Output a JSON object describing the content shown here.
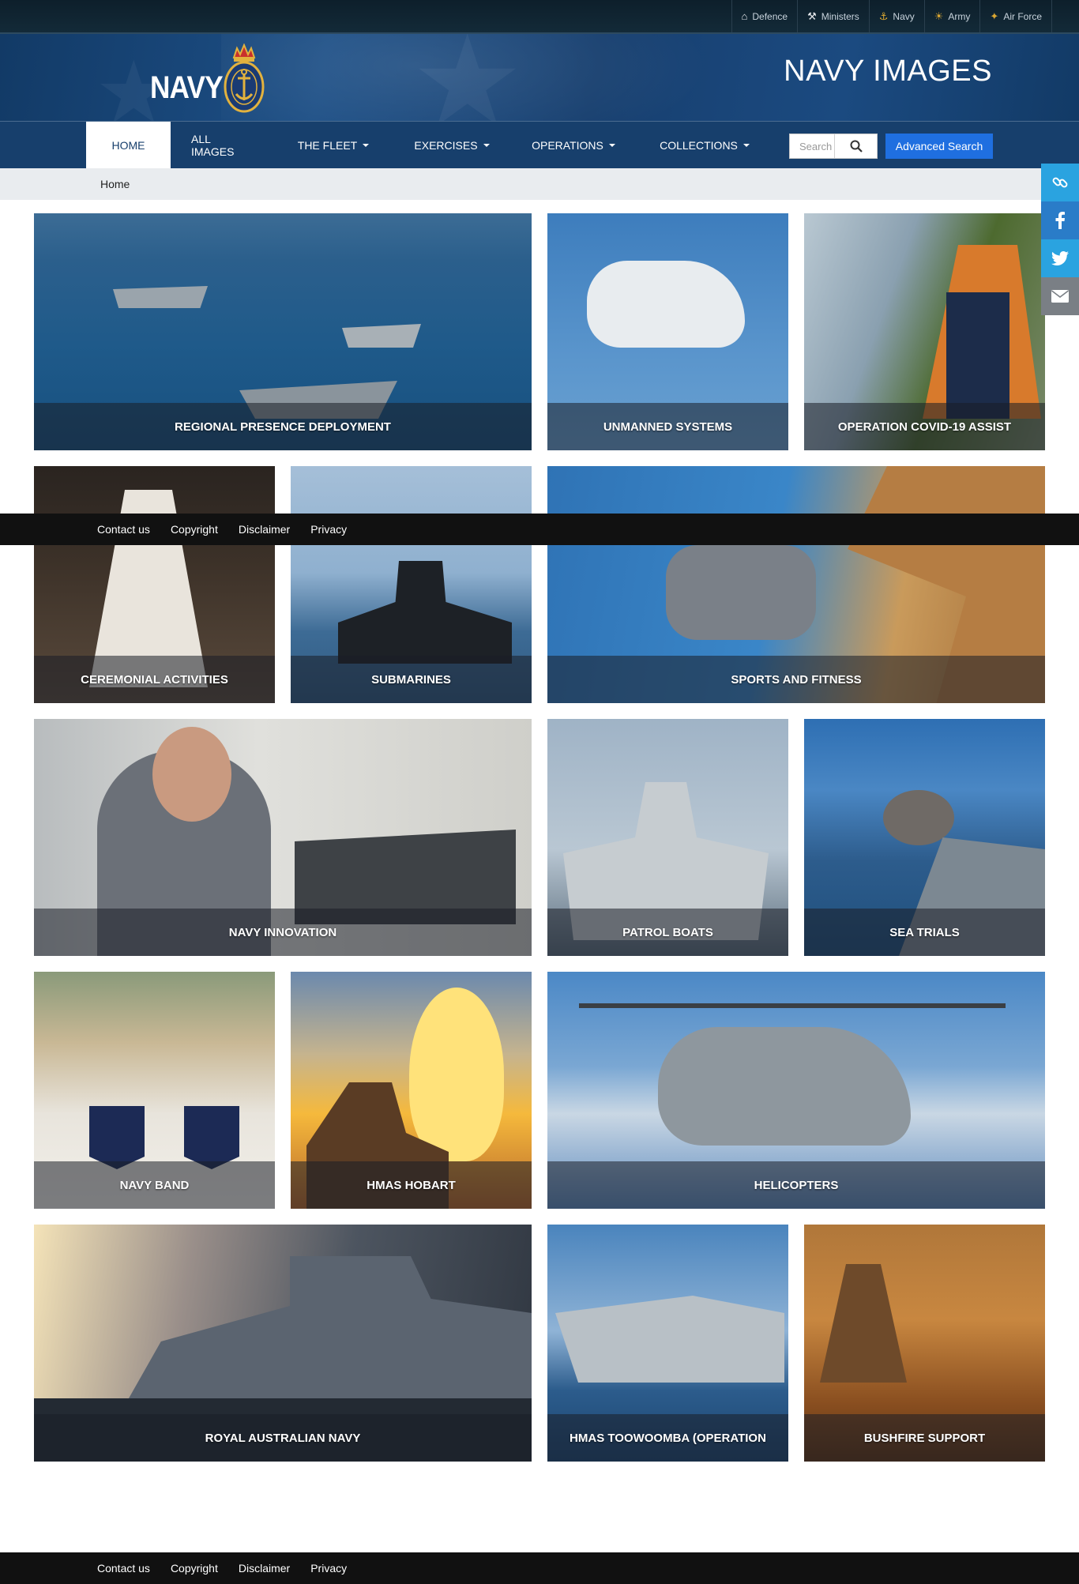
{
  "utility_links": [
    {
      "label": "Defence",
      "icon": "home-icon"
    },
    {
      "label": "Ministers",
      "icon": "ministers-icon"
    },
    {
      "label": "Navy",
      "icon": "navy-badge-icon"
    },
    {
      "label": "Army",
      "icon": "army-badge-icon"
    },
    {
      "label": "Air Force",
      "icon": "airforce-badge-icon"
    }
  ],
  "banner": {
    "logo_text": "NAVY",
    "title": "NAVY IMAGES"
  },
  "nav": {
    "items": [
      {
        "label": "HOME",
        "active": true,
        "dropdown": false
      },
      {
        "label": "ALL IMAGES",
        "dropdown": false
      },
      {
        "label": "THE FLEET",
        "dropdown": true
      },
      {
        "label": "EXERCISES",
        "dropdown": true
      },
      {
        "label": "OPERATIONS",
        "dropdown": true
      },
      {
        "label": "COLLECTIONS",
        "dropdown": true
      }
    ],
    "search_placeholder": "Search",
    "advanced_search_label": "Advanced Search"
  },
  "breadcrumb": "Home",
  "social": [
    "link-icon",
    "facebook-icon",
    "twitter-icon",
    "email-icon"
  ],
  "tiles": [
    {
      "caption": "REGIONAL PRESENCE DEPLOYMENT"
    },
    {
      "caption": "UNMANNED SYSTEMS"
    },
    {
      "caption": "OPERATION COVID-19 ASSIST"
    },
    {
      "caption": "CEREMONIAL ACTIVITIES"
    },
    {
      "caption": "SUBMARINES"
    },
    {
      "caption": "SPORTS AND FITNESS"
    },
    {
      "caption": "NAVY INNOVATION"
    },
    {
      "caption": "PATROL BOATS"
    },
    {
      "caption": "SEA TRIALS"
    },
    {
      "caption": "NAVY BAND"
    },
    {
      "caption": "HMAS HOBART"
    },
    {
      "caption": "HELICOPTERS"
    },
    {
      "caption": "ROYAL AUSTRALIAN NAVY"
    },
    {
      "caption": "HMAS TOOWOOMBA (OPERATION"
    },
    {
      "caption": "BUSHFIRE SUPPORT"
    }
  ],
  "footer_links": [
    "Contact us",
    "Copyright",
    "Disclaimer",
    "Privacy"
  ],
  "colors": {
    "nav_bg": "#173f6c",
    "accent_button": "#1f6fe0",
    "social_bg": "#2aa3e0",
    "footer_bg": "#111111"
  }
}
